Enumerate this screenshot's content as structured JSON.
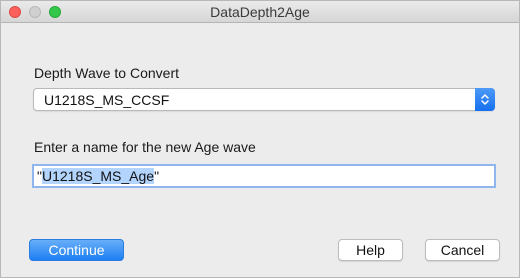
{
  "window": {
    "title": "DataDepth2Age"
  },
  "depth": {
    "label": "Depth Wave to Convert",
    "selected": "U1218S_MS_CCSF"
  },
  "name": {
    "label": "Enter a name for the new Age wave",
    "quote_open": "\"",
    "selected_text": "U1218S_MS_Age",
    "quote_close": "\""
  },
  "buttons": {
    "continue": "Continue",
    "help": "Help",
    "cancel": "Cancel"
  },
  "colors": {
    "accent": "#1d7ff2",
    "selection": "#b3d4fc",
    "close": "#fc605c",
    "maximize": "#34c84a"
  },
  "icons": {
    "stepper": "chevron-updown-icon"
  }
}
